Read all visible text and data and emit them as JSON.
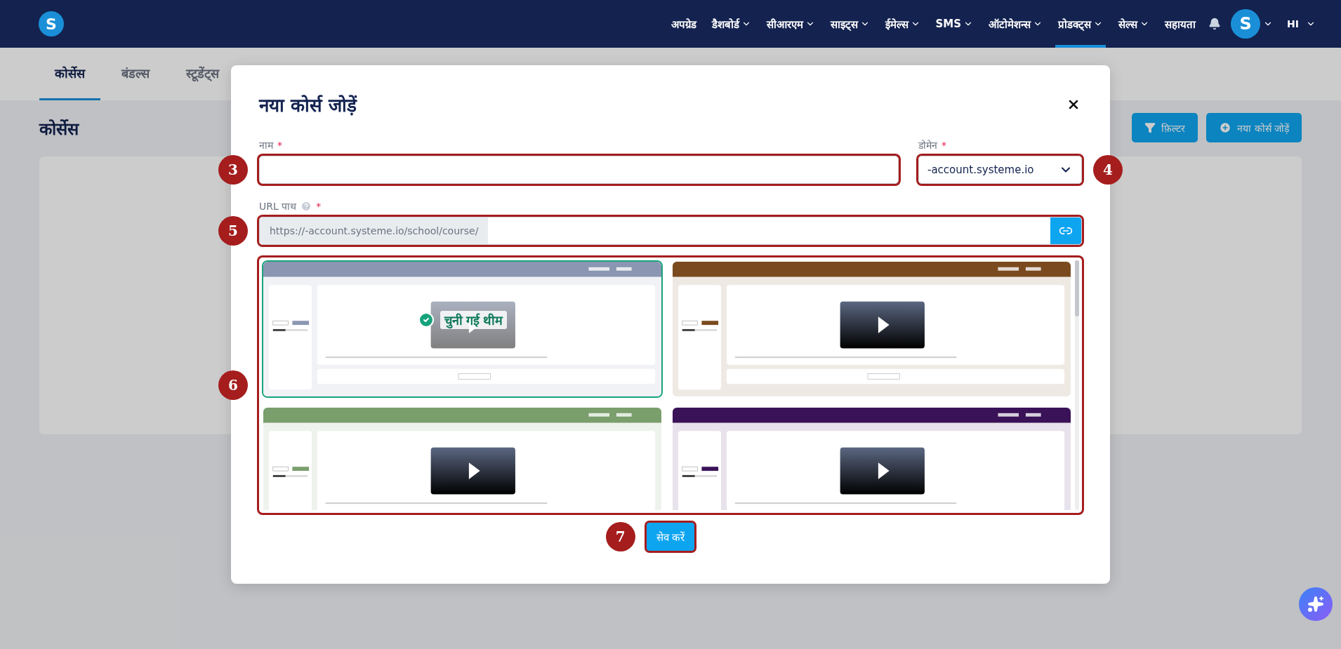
{
  "nav": {
    "logo": "S",
    "items": [
      {
        "label": "अपग्रेड",
        "dropdown": false,
        "selected": false
      },
      {
        "label": "डैशबोर्ड",
        "dropdown": true,
        "selected": false
      },
      {
        "label": "सीआरएम",
        "dropdown": true,
        "selected": false
      },
      {
        "label": "साइट्स",
        "dropdown": true,
        "selected": false
      },
      {
        "label": "ईमेल्स",
        "dropdown": true,
        "selected": false
      },
      {
        "label": "SMS",
        "dropdown": true,
        "selected": false
      },
      {
        "label": "ऑटोमेशन्स",
        "dropdown": true,
        "selected": false
      },
      {
        "label": "प्रोडक्ट्स",
        "dropdown": true,
        "selected": true
      },
      {
        "label": "सेल्स",
        "dropdown": true,
        "selected": false
      },
      {
        "label": "सहायता",
        "dropdown": false,
        "selected": false
      }
    ],
    "avatar": "S",
    "language": "HI"
  },
  "tabs": [
    {
      "label": "कोर्सेस",
      "selected": true
    },
    {
      "label": "बंडल्स",
      "selected": false
    },
    {
      "label": "स्टूडेंट्स",
      "selected": false
    }
  ],
  "page": {
    "title": "कोर्सेस",
    "buttons": [
      "फ़िल्टर",
      "नया कोर्स जोड़ें"
    ]
  },
  "modal": {
    "title": "नया कोर्स जोड़ें",
    "name_field": {
      "label": "नाम",
      "required_mark": "*",
      "marker": "3"
    },
    "domain_field": {
      "label": "डोमेन",
      "required_mark": "*",
      "value": "-account.systeme.io",
      "marker": "4"
    },
    "url_field": {
      "label": "URL पाथ",
      "required_mark": "*",
      "prefix": "https://-account.systeme.io/school/course/",
      "marker": "5"
    },
    "themes_marker": "6",
    "selected_label": "चुनी गई थीम",
    "themes": [
      {
        "color": "#8a96b2",
        "selected": true
      },
      {
        "color": "#7a4a1e",
        "selected": false
      },
      {
        "color": "#7a9e6c",
        "selected": false
      },
      {
        "color": "#3a1258",
        "selected": false
      }
    ],
    "save_button": "सेव करें",
    "save_marker": "7"
  }
}
